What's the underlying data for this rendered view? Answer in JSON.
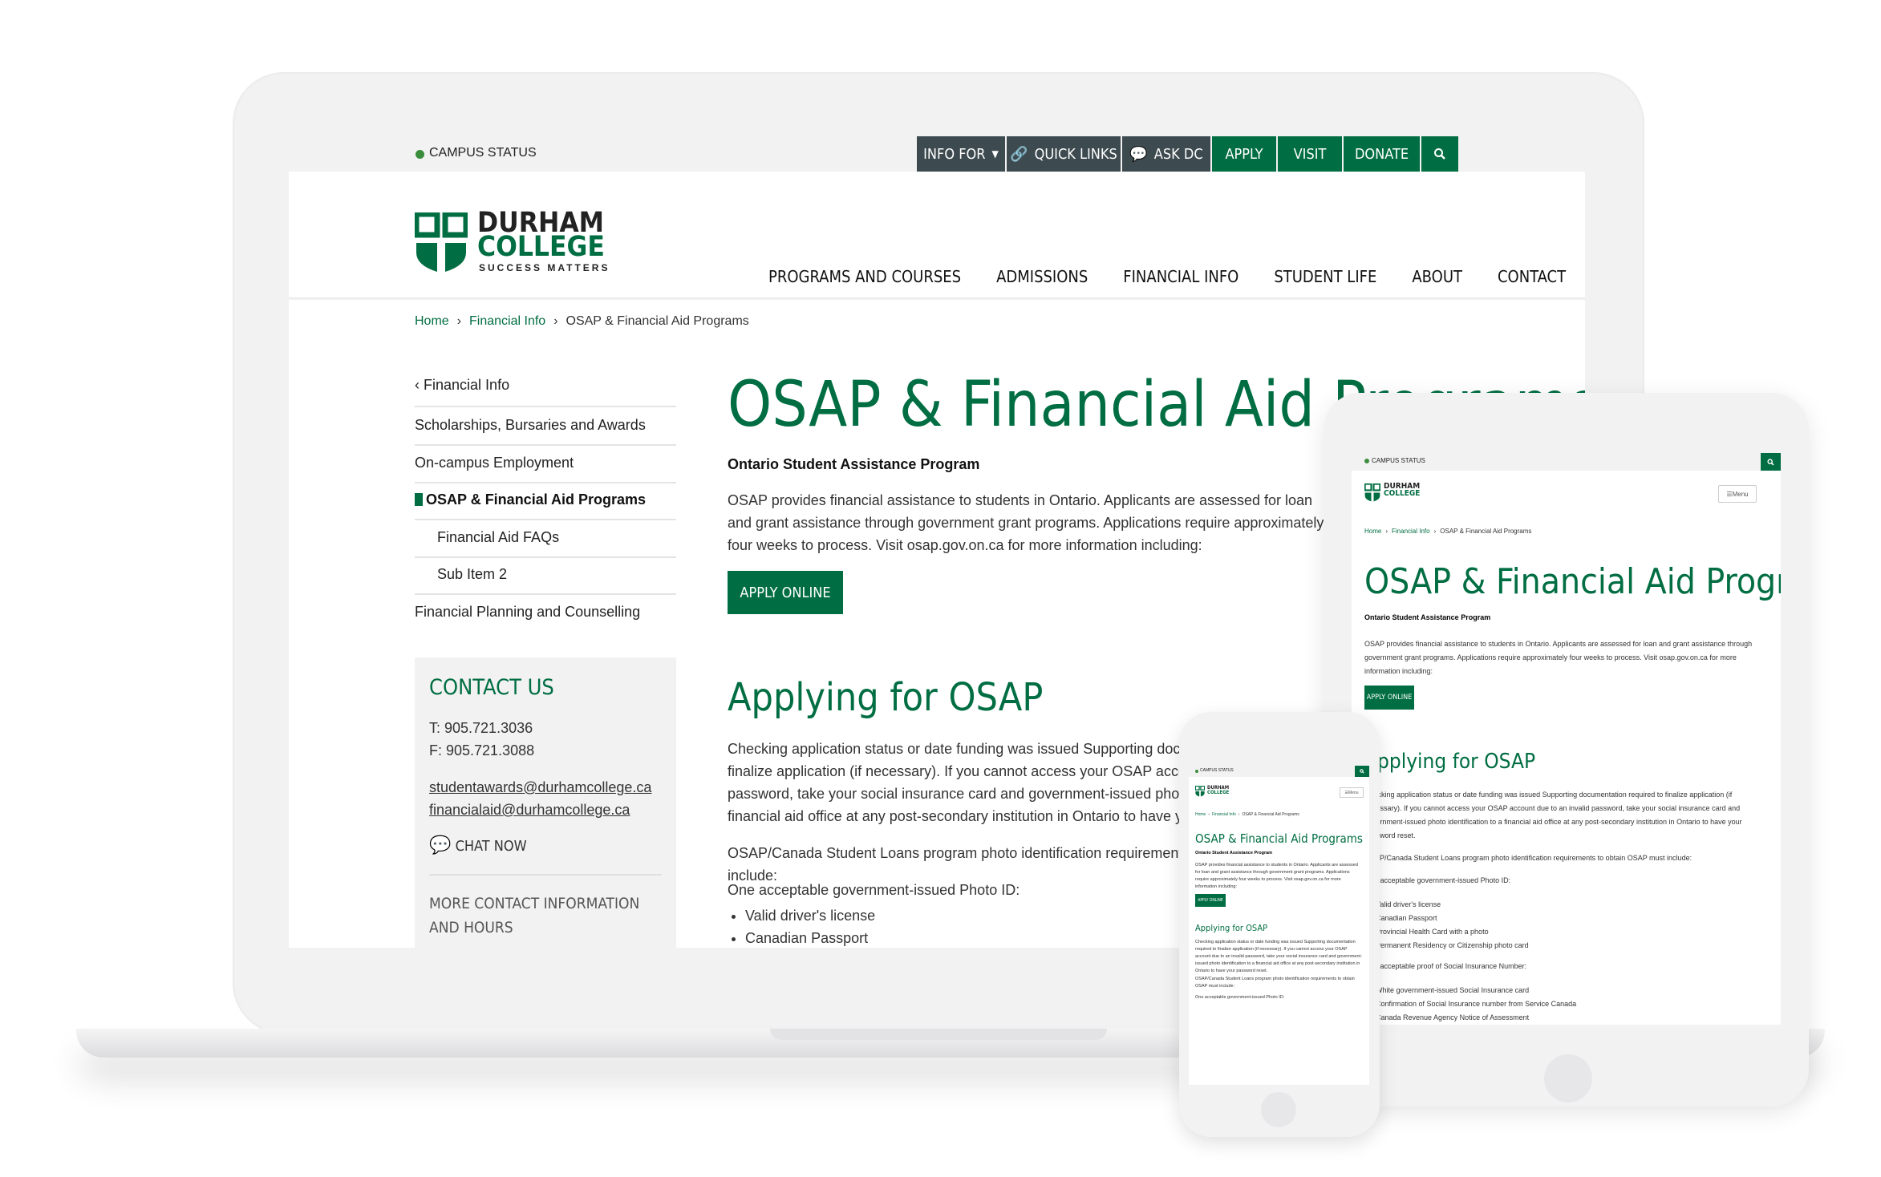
{
  "utility": {
    "campus_status": "CAMPUS STATUS",
    "info_for": "INFO FOR",
    "quick_links": "QUICK LINKS",
    "ask_dc": "ASK DC",
    "apply": "APPLY",
    "visit": "VISIT",
    "donate": "DONATE"
  },
  "logo": {
    "line1": "DURHAM",
    "line2": "COLLEGE",
    "tagline": "SUCCESS MATTERS"
  },
  "nav": [
    "PROGRAMS AND COURSES",
    "ADMISSIONS",
    "FINANCIAL INFO",
    "STUDENT LIFE",
    "ABOUT",
    "CONTACT"
  ],
  "breadcrumb": {
    "home": "Home",
    "parent": "Financial Info",
    "current": "OSAP & Financial Aid Programs"
  },
  "sidebar": {
    "back": "Financial Info",
    "items": [
      "Scholarships, Bursaries and Awards",
      "On-campus Employment",
      "OSAP & Financial Aid Programs",
      "Financial Aid FAQs",
      "Sub Item 2",
      "Financial Planning and Counselling"
    ]
  },
  "contact": {
    "title": "CONTACT US",
    "phone": "T: 905.721.3036",
    "fax": "F: 905.721.3088",
    "email1": "studentawards@durhamcollege.ca",
    "email2": "financialaid@durhamcollege.ca",
    "chat": "CHAT NOW",
    "more": "MORE CONTACT INFORMATION AND HOURS"
  },
  "main": {
    "title": "OSAP & Financial Aid Programs",
    "subtitle": "Ontario Student Assistance Program",
    "intro": "OSAP provides financial assistance to students in Ontario. Applicants are assessed for loan and grant assistance through government grant programs. Applications require approximately four weeks to process. Visit osap.gov.on.ca for more information including:",
    "apply_online": "APPLY ONLINE",
    "h2": "Applying for OSAP",
    "para2": "Checking application status or date funding was issued Supporting documentation required to finalize application (if necessary). If you cannot access your OSAP account due to an invalid password, take your social insurance card and government-issued photo identification to a financial aid office at any post-secondary institution in Ontario to have your password reset.",
    "para3": "OSAP/Canada Student Loans program photo identification requirements to obtain OSAP must include:",
    "para4": "One acceptable government-issued Photo ID:",
    "list1": [
      "Valid driver's license",
      "Canadian Passport",
      "Provincial Health Card with a photo",
      "Permanent Residency or Citizenship photo card"
    ],
    "para5": "One acceptable proof of Social Insurance Number:",
    "list2": [
      "White government-issued Social Insurance card",
      "Confirmation of Social Insurance number from Service Canada",
      "Canada Revenue Agency Notice of Assessment"
    ]
  },
  "mobile": {
    "menu": "Menu"
  }
}
